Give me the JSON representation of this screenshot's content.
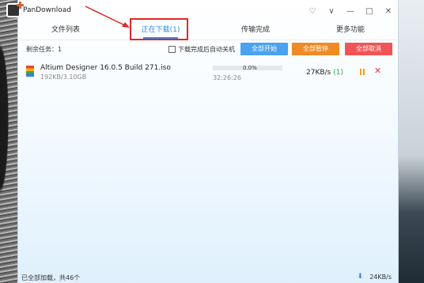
{
  "app": {
    "title": "PanDownload"
  },
  "window_controls": {
    "skin": "♡",
    "menu": "∨",
    "minimize": "—",
    "maximize": "□",
    "close": "✕"
  },
  "tabs": [
    {
      "label": "文件列表"
    },
    {
      "label": "正在下载(1)"
    },
    {
      "label": "传输完成"
    },
    {
      "label": "更多功能"
    }
  ],
  "toolbar": {
    "remaining": "剩余任务：1",
    "auto_shutdown": "下载完成后自动关机",
    "start_all": "全部开始",
    "pause_all": "全部暂停",
    "cancel_all": "全部取消"
  },
  "downloads": [
    {
      "name": "Altium Designer 16.0.5 Build 271.iso",
      "size": "192KB/3.10GB",
      "progress": 0.0,
      "percent": "0.0%",
      "time": "32:26:26",
      "speed": "27KB/s",
      "connections": "(1)"
    }
  ],
  "status": {
    "text": "已全部加载，共46个",
    "total_speed": "24KB/s"
  },
  "colors": {
    "accent": "#2e8ae6",
    "start": "#4aa3f0",
    "pause": "#f08a24",
    "cancel": "#f05454",
    "annotation": "#e0282a"
  }
}
